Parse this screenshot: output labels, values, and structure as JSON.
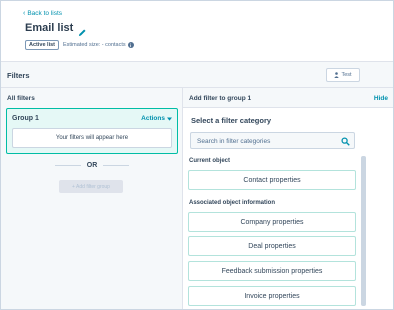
{
  "header": {
    "back_label": "Back to lists",
    "title": "Email list",
    "badge": "Active list",
    "estimated_size": "Estimated size: - contacts"
  },
  "filters_bar": {
    "title": "Filters",
    "test_label": "Test"
  },
  "left_panel": {
    "all_filters": "All filters",
    "group": {
      "label": "Group 1",
      "actions_label": "Actions",
      "empty_text": "Your filters will appear here"
    },
    "or_text": "OR",
    "add_group_label": "+ Add filter group"
  },
  "right_panel": {
    "title": "Add filter to group 1",
    "hide_label": "Hide",
    "select_title": "Select a filter category",
    "search_placeholder": "Search in filter categories",
    "current_object_label": "Current object",
    "contact_properties": "Contact properties",
    "associated_label": "Associated object information",
    "associated_items": [
      "Company properties",
      "Deal properties",
      "Feedback submission properties",
      "Invoice properties"
    ]
  },
  "colors": {
    "accent": "#0091ae",
    "group_border": "#00bda5",
    "group_bg": "#e5f8f6",
    "text": "#33475b"
  }
}
